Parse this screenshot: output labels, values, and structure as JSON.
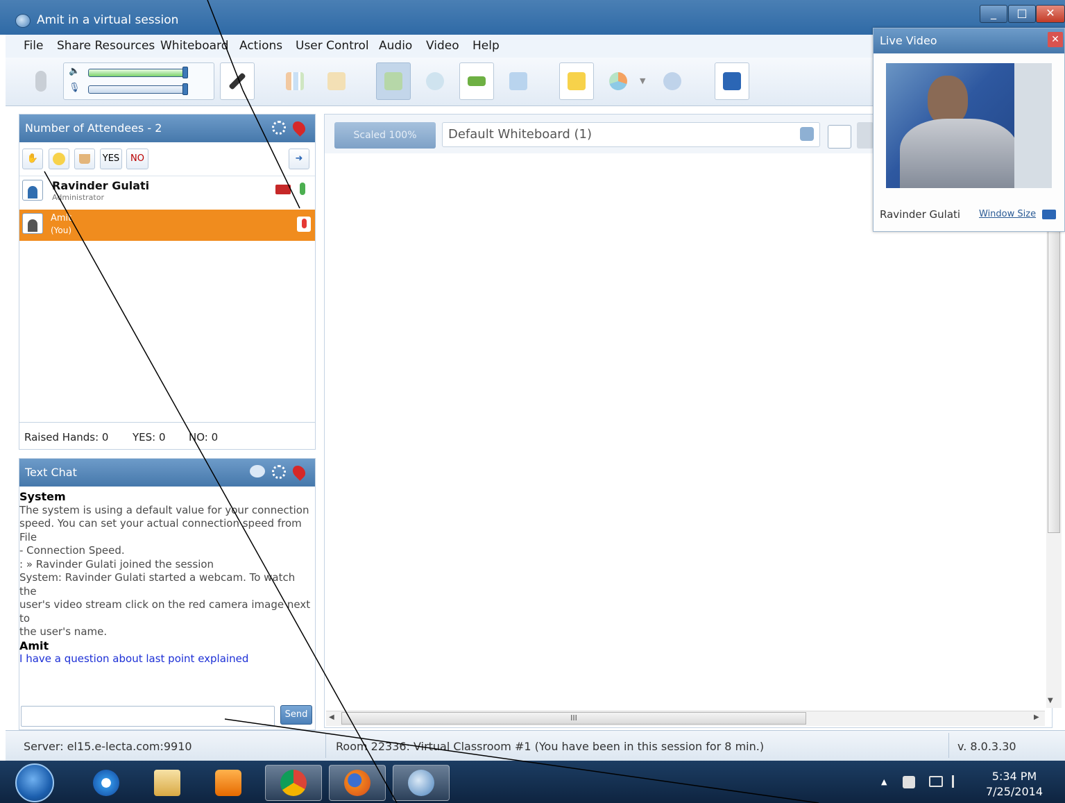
{
  "window": {
    "title": "Amit in a virtual session",
    "min": "_",
    "max": "□",
    "close": "✕"
  },
  "menu": [
    "File",
    "Share Resources",
    "Whiteboard",
    "Actions",
    "User Control",
    "Audio",
    "Video",
    "Help"
  ],
  "attendees": {
    "header": "Number of Attendees - 2",
    "buttons": {
      "yes": "YES",
      "no": "NO"
    },
    "users": [
      {
        "name": "Ravinder Gulati",
        "role": "Administrator"
      },
      {
        "name": "Amit",
        "role": "(You)"
      }
    ],
    "stats": {
      "raised": "Raised Hands: 0",
      "yes": "YES: 0",
      "no": "NO: 0"
    }
  },
  "chat": {
    "header": "Text Chat",
    "messages": [
      {
        "sender": "System",
        "lines": [
          "The system is using a default value for your connection",
          "speed. You can set your actual connection speed from File",
          "- Connection Speed.",
          ": » Ravinder Gulati joined the session",
          "System: Ravinder Gulati started a webcam. To watch the",
          "user's video stream click on the red camera image next to",
          "the user's name."
        ]
      },
      {
        "sender": "Amit",
        "lines": [
          "I have a question about last point explained"
        ]
      }
    ],
    "input_value": "",
    "send_label": "Send"
  },
  "whiteboard": {
    "scale_label": "Scaled 100%",
    "selected": "Default Whiteboard (1)",
    "hscroll_grip": "III"
  },
  "live_video": {
    "title": "Live Video",
    "user": "Ravinder Gulati",
    "window_size": "Window Size"
  },
  "status": {
    "server": "Server: el15.e-lecta.com:9910",
    "room": "Room 22336: Virtual Classroom #1 (You have been in this session for 8 min.)",
    "version": "v. 8.0.3.30"
  },
  "taskbar": {
    "time": "5:34 PM",
    "date": "7/25/2014"
  }
}
